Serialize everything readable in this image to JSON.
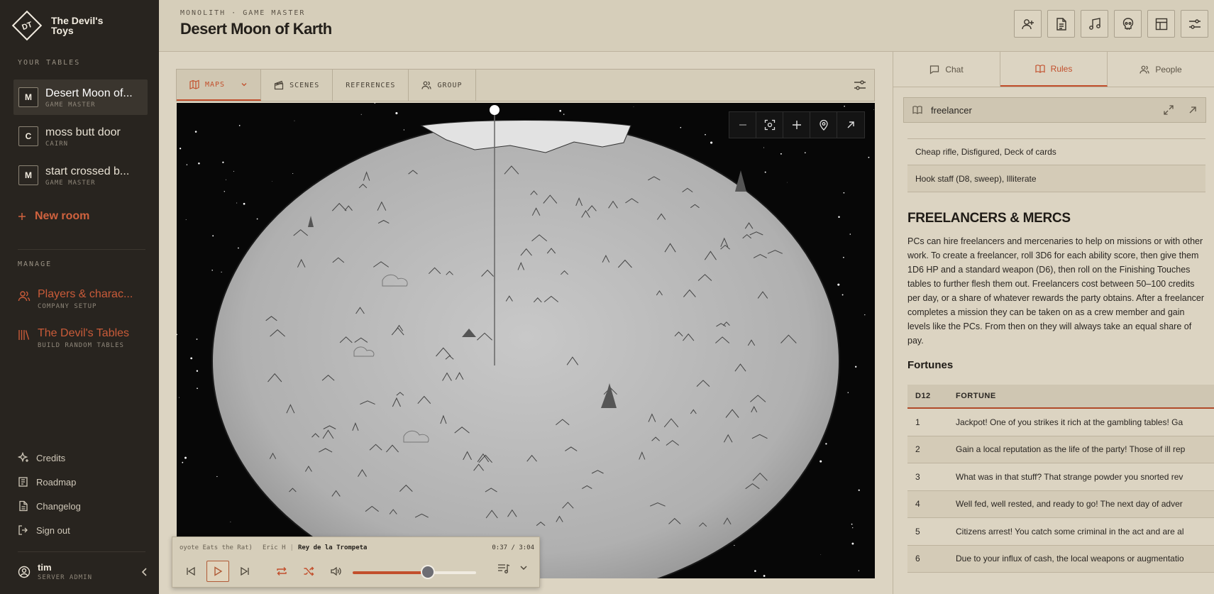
{
  "brand": {
    "name": "The Devil's Toys",
    "mark": "DT"
  },
  "sidebar": {
    "tables_heading": "YOUR TABLES",
    "rooms": [
      {
        "badge": "M",
        "name": "Desert Moon of...",
        "role": "GAME MASTER"
      },
      {
        "badge": "C",
        "name": "moss butt door",
        "role": "CAIRN"
      },
      {
        "badge": "M",
        "name": "start crossed b...",
        "role": "GAME MASTER"
      }
    ],
    "new_room": "New room",
    "manage_heading": "MANAGE",
    "manage": [
      {
        "name": "Players & charac...",
        "sub": "COMPANY SETUP",
        "icon": "users-icon"
      },
      {
        "name": "The Devil's Tables",
        "sub": "BUILD RANDOM TABLES",
        "icon": "library-icon"
      }
    ],
    "footer_links": [
      {
        "label": "Credits",
        "icon": "sparkles-icon"
      },
      {
        "label": "Roadmap",
        "icon": "roadmap-icon"
      },
      {
        "label": "Changelog",
        "icon": "document-icon"
      },
      {
        "label": "Sign out",
        "icon": "sign-out-icon"
      }
    ],
    "user": {
      "name": "tim",
      "role": "SERVER ADMIN"
    }
  },
  "header": {
    "eyebrow": "MONOLITH · GAME MASTER",
    "title": "Desert Moon of Karth",
    "tools": [
      "add-player-icon",
      "document-icon",
      "music-icon",
      "skull-icon",
      "layout-icon",
      "settings-icon"
    ]
  },
  "main": {
    "tabs": [
      {
        "label": "MAPS",
        "icon": "map-icon",
        "active": true
      },
      {
        "label": "SCENES",
        "icon": "clapper-icon",
        "active": false
      },
      {
        "label": "REFERENCES",
        "icon": "",
        "active": false
      },
      {
        "label": "GROUP",
        "icon": "users-icon",
        "active": false
      }
    ]
  },
  "player": {
    "prev_track": "oyote Eats the Rat)",
    "artist": "Eric H",
    "separator": "|",
    "title": "Rey de la Trompeta",
    "time": "0:37 / 3:04",
    "progress": 0.61
  },
  "rpanel": {
    "tabs": [
      {
        "label": "Chat",
        "icon": "chat-icon",
        "active": false
      },
      {
        "label": "Rules",
        "icon": "book-icon",
        "active": true
      },
      {
        "label": "People",
        "icon": "users-icon",
        "active": false
      }
    ],
    "search_value": "freelancer",
    "rows": [
      "Cheap rifle, Disfigured, Deck of cards",
      "Hook staff (D8, sweep), Illiterate"
    ],
    "heading": "FREELANCERS & MERCS",
    "paragraph": "PCs can hire freelancers and mercenaries to help on missions or with other work. To create a freelancer, roll 3D6 for each ability score, then give them 1D6 HP and a standard weapon (D6), then roll on the Finishing Touches tables to further flesh them out. Freelancers cost between 50–100 credits per day, or a share of whatever rewards the party obtains. After a freelancer completes a mission they can be taken on as a crew member and gain levels like the PCs. From then on they will always take an equal share of pay.",
    "subheading": "Fortunes",
    "table": {
      "headers": [
        "D12",
        "FORTUNE"
      ],
      "rows": [
        [
          "1",
          "Jackpot! One of you strikes it rich at the gambling tables! Ga"
        ],
        [
          "2",
          "Gain a local reputation as the life of the party! Those of ill rep"
        ],
        [
          "3",
          "What was in that stuff? That strange powder you snorted rev"
        ],
        [
          "4",
          "Well fed, well rested, and ready to go! The next day of adver"
        ],
        [
          "5",
          "Citizens arrest! You catch some criminal in the act and are al"
        ],
        [
          "6",
          "Due to your influx of cash, the local weapons or augmentatio"
        ]
      ]
    }
  },
  "colors": {
    "accent": "#c24f2c",
    "sidebar": "#28241f",
    "paper": "#dcd4c2"
  }
}
